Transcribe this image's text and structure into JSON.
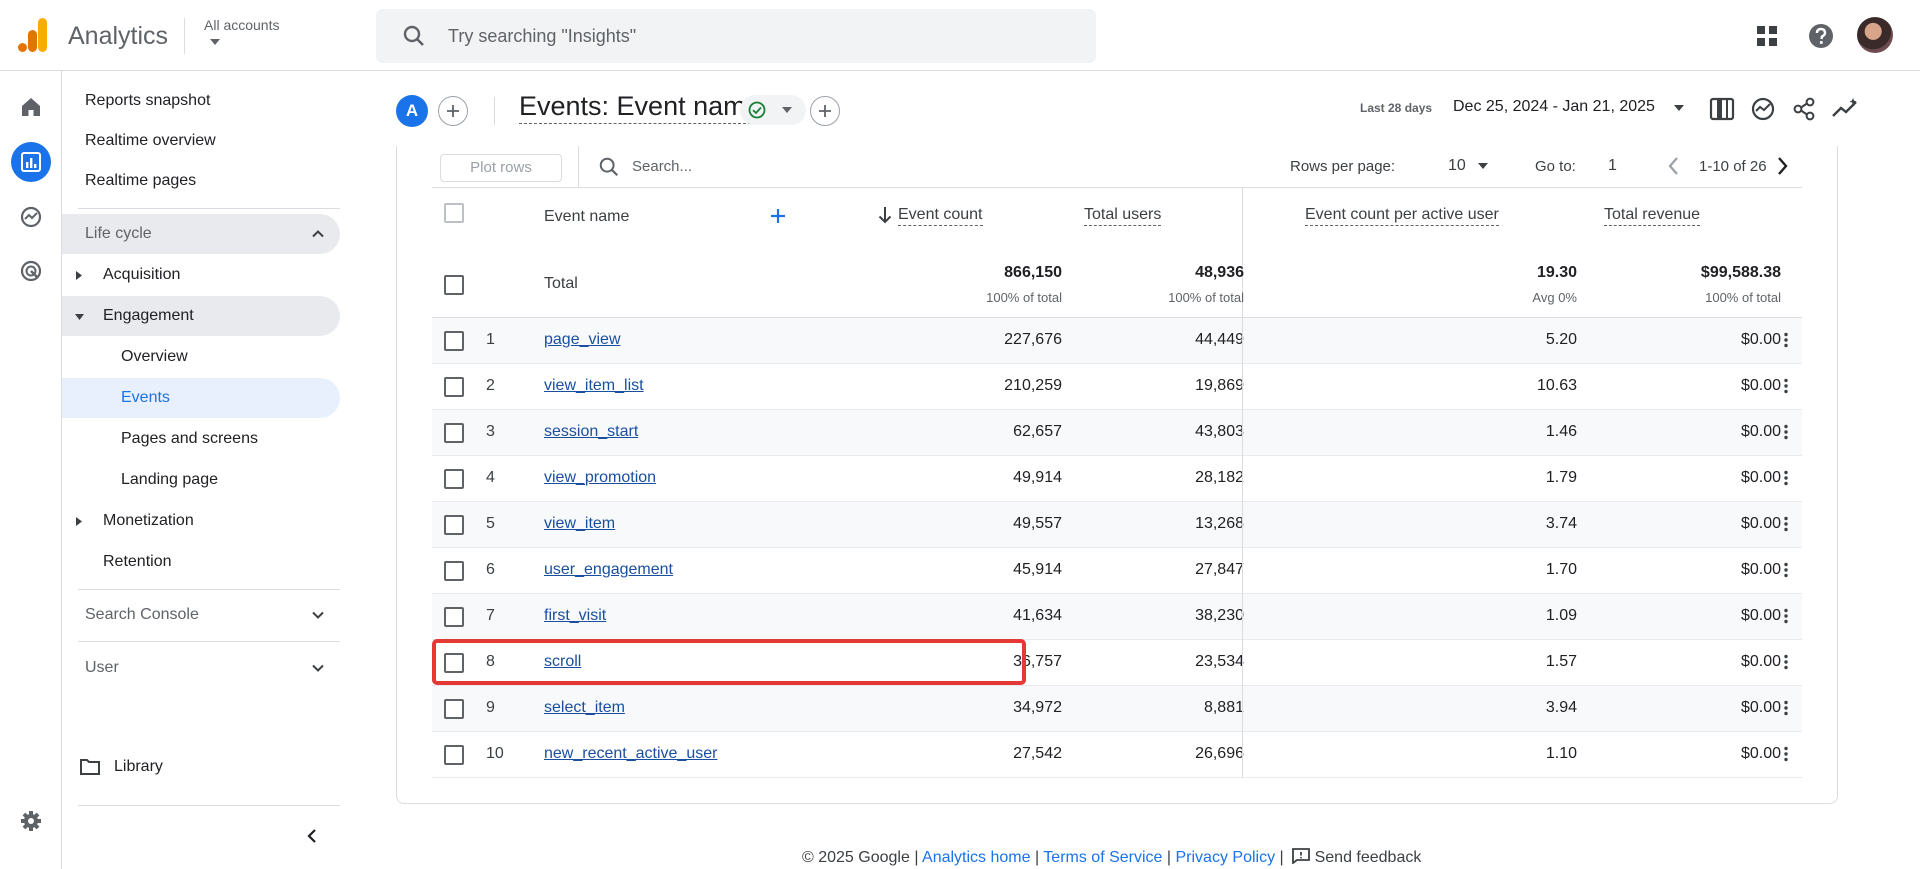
{
  "app": {
    "title": "Analytics",
    "account_label": "All accounts",
    "search_placeholder": "Try searching \"Insights\""
  },
  "nav": {
    "items": [
      {
        "label": "Reports snapshot"
      },
      {
        "label": "Realtime overview"
      },
      {
        "label": "Realtime pages"
      }
    ],
    "lifecycle": "Life cycle",
    "acquisition": "Acquisition",
    "engagement": "Engagement",
    "engagement_children": [
      "Overview",
      "Events",
      "Pages and screens",
      "Landing page"
    ],
    "monetization": "Monetization",
    "retention": "Retention",
    "search_console": "Search Console",
    "user": "User",
    "library": "Library"
  },
  "report": {
    "badge": "A",
    "title": "Events: Event name",
    "date_label": "Last 28 days",
    "date_range": "Dec 25, 2024 - Jan 21, 2025"
  },
  "toolbar": {
    "plot_rows": "Plot rows",
    "search_placeholder": "Search...",
    "rows_per_page_label": "Rows per page:",
    "rows_per_page": "10",
    "goto_label": "Go to:",
    "goto_value": "1",
    "range": "1-10 of 26"
  },
  "table": {
    "headers": {
      "event_name": "Event name",
      "event_count": "Event count",
      "total_users": "Total users",
      "per_user": "Event count per active user",
      "revenue": "Total revenue"
    },
    "total": {
      "label": "Total",
      "event_count": "866,150",
      "event_count_sub": "100% of total",
      "total_users": "48,936",
      "total_users_sub": "100% of total",
      "per_user": "19.30",
      "per_user_sub": "Avg 0%",
      "revenue": "$99,588.38",
      "revenue_sub": "100% of total"
    },
    "rows": [
      {
        "n": "1",
        "name": "page_view",
        "count": "227,676",
        "users": "44,449",
        "per_user": "5.20",
        "revenue": "$0.00"
      },
      {
        "n": "2",
        "name": "view_item_list",
        "count": "210,259",
        "users": "19,869",
        "per_user": "10.63",
        "revenue": "$0.00"
      },
      {
        "n": "3",
        "name": "session_start",
        "count": "62,657",
        "users": "43,803",
        "per_user": "1.46",
        "revenue": "$0.00"
      },
      {
        "n": "4",
        "name": "view_promotion",
        "count": "49,914",
        "users": "28,182",
        "per_user": "1.79",
        "revenue": "$0.00"
      },
      {
        "n": "5",
        "name": "view_item",
        "count": "49,557",
        "users": "13,268",
        "per_user": "3.74",
        "revenue": "$0.00"
      },
      {
        "n": "6",
        "name": "user_engagement",
        "count": "45,914",
        "users": "27,847",
        "per_user": "1.70",
        "revenue": "$0.00"
      },
      {
        "n": "7",
        "name": "first_visit",
        "count": "41,634",
        "users": "38,230",
        "per_user": "1.09",
        "revenue": "$0.00"
      },
      {
        "n": "8",
        "name": "scroll",
        "count": "36,757",
        "users": "23,534",
        "per_user": "1.57",
        "revenue": "$0.00"
      },
      {
        "n": "9",
        "name": "select_item",
        "count": "34,972",
        "users": "8,881",
        "per_user": "3.94",
        "revenue": "$0.00"
      },
      {
        "n": "10",
        "name": "new_recent_active_user",
        "count": "27,542",
        "users": "26,696",
        "per_user": "1.10",
        "revenue": "$0.00"
      }
    ]
  },
  "footer": {
    "copyright": "© 2025 Google |",
    "home": "Analytics home",
    "sep1": "|",
    "terms": "Terms of Service",
    "sep2": "|",
    "privacy": "Privacy Policy",
    "sep3": "|",
    "feedback": "Send feedback"
  },
  "colors": {
    "accent": "#1a73e8",
    "highlight_border": "#e53935",
    "logo_orange": "#f9ab00",
    "logo_dark": "#e37400"
  }
}
